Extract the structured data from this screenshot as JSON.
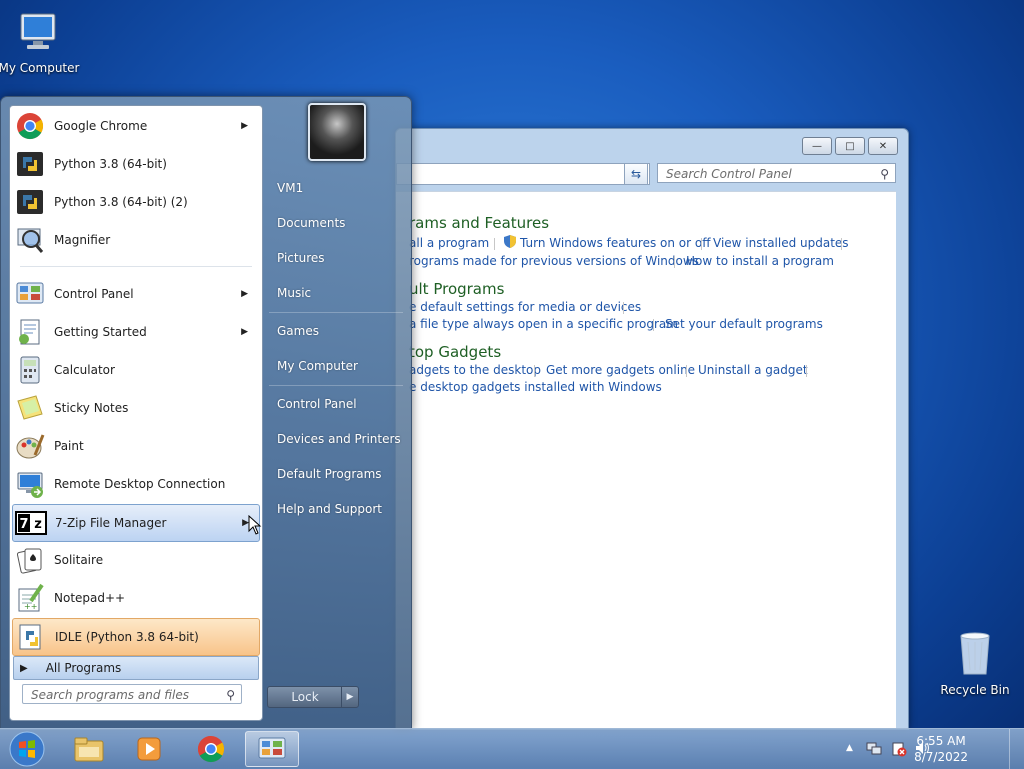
{
  "desktop": {
    "icons": [
      {
        "label": "My Computer"
      },
      {
        "label": "Recycle Bin"
      }
    ]
  },
  "control_panel": {
    "search_placeholder": "Search Control Panel",
    "categories": [
      {
        "title": "rams and Features",
        "links": [
          "all a program",
          "Turn Windows features on or off",
          "View installed updates",
          "rograms made for previous versions of Windows",
          "How to install a program"
        ]
      },
      {
        "title": "ult Programs",
        "links": [
          "e default settings for media or devices",
          "a file type always open in a specific program",
          "Set your default programs"
        ]
      },
      {
        "title": "top Gadgets",
        "links": [
          "adgets to the desktop",
          "Get more gadgets online",
          "Uninstall a gadget",
          "e desktop gadgets installed with Windows"
        ]
      }
    ]
  },
  "start_menu": {
    "programs": [
      {
        "label": "Google Chrome",
        "icon": "chrome-icon",
        "submenu": true
      },
      {
        "label": "Python 3.8 (64-bit)",
        "icon": "python-icon",
        "submenu": false
      },
      {
        "label": "Python 3.8 (64-bit) (2)",
        "icon": "python-icon",
        "submenu": false
      },
      {
        "label": "Magnifier",
        "icon": "magnifier-icon",
        "submenu": false
      },
      {
        "label": "Control Panel",
        "icon": "control-panel-icon",
        "submenu": true
      },
      {
        "label": "Getting Started",
        "icon": "getting-started-icon",
        "submenu": true
      },
      {
        "label": "Calculator",
        "icon": "calculator-icon",
        "submenu": false
      },
      {
        "label": "Sticky Notes",
        "icon": "sticky-notes-icon",
        "submenu": false
      },
      {
        "label": "Paint",
        "icon": "paint-icon",
        "submenu": false
      },
      {
        "label": "Remote Desktop Connection",
        "icon": "remote-desktop-icon",
        "submenu": false
      },
      {
        "label": "7-Zip File Manager",
        "icon": "7zip-icon",
        "submenu": true
      },
      {
        "label": "Solitaire",
        "icon": "solitaire-icon",
        "submenu": false
      },
      {
        "label": "Notepad++",
        "icon": "notepadpp-icon",
        "submenu": false
      },
      {
        "label": "IDLE (Python 3.8 64-bit)",
        "icon": "idle-icon",
        "submenu": false
      }
    ],
    "all_programs": "All Programs",
    "search_placeholder": "Search programs and files",
    "right_items": [
      "VM1",
      "Documents",
      "Pictures",
      "Music",
      "Games",
      "My Computer",
      "Control Panel",
      "Devices and Printers",
      "Default Programs",
      "Help and Support"
    ],
    "lock_label": "Lock"
  },
  "taskbar": {
    "time": "6:55 AM",
    "date": "8/7/2022"
  }
}
